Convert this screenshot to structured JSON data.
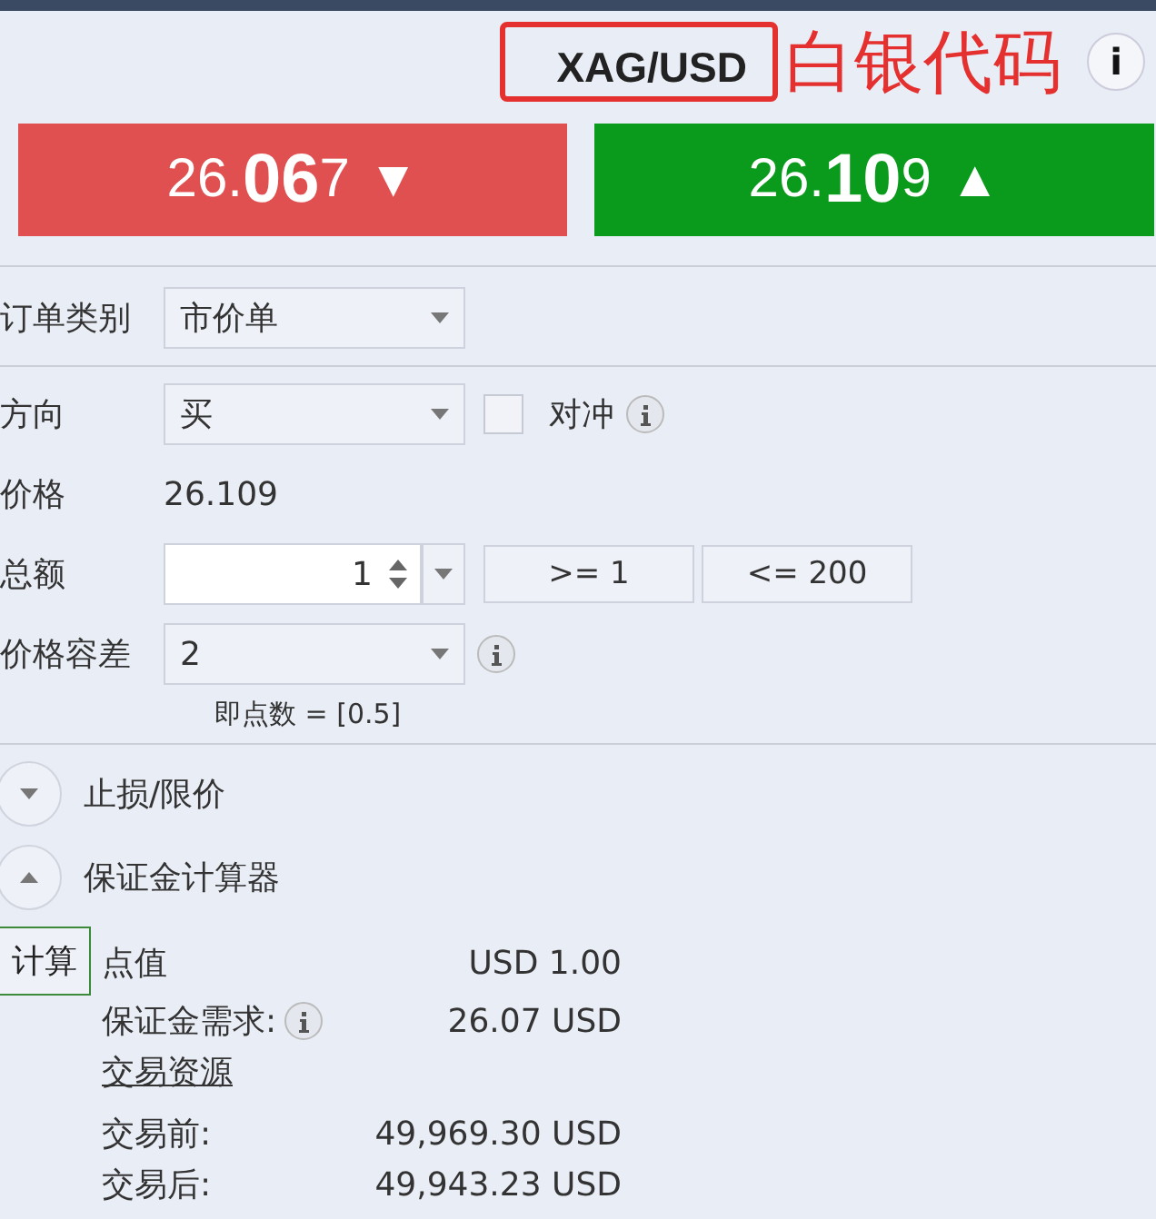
{
  "header": {
    "symbol": "XAG/USD",
    "symbol_highlighted": true,
    "annotation": "白银代码",
    "info": "i"
  },
  "quotes": [
    {
      "kind": "sell",
      "prefix": "26.",
      "big": "06",
      "suffix": "7",
      "arrow": "▼"
    },
    {
      "kind": "buy",
      "prefix": "26.",
      "big": "10",
      "suffix": "9",
      "arrow": "▲"
    }
  ],
  "order_type": {
    "label": "订单类别",
    "value": "市价单"
  },
  "direction": {
    "label": "方向",
    "value": "买",
    "hedge": {
      "label": "对冲",
      "checked": false
    }
  },
  "price": {
    "label": "价格",
    "value": "26.109"
  },
  "amount": {
    "label": "总额",
    "value": "1",
    "min": ">= 1",
    "max": "<= 200"
  },
  "slippage": {
    "label": "价格容差",
    "value": "2",
    "note": "即点数 = [0.5]"
  },
  "sections": [
    {
      "label": "止损/限价",
      "expanded": false
    },
    {
      "label": "保证金计算器",
      "expanded": true
    }
  ],
  "calculator": {
    "button": "计算",
    "rows": [
      {
        "label": "点值",
        "value": "USD 1.00",
        "info": false
      },
      {
        "label": "保证金需求:",
        "value": "26.07 USD",
        "info": true
      }
    ],
    "link": "交易资源",
    "balances": [
      {
        "label": "交易前:",
        "value": "49,969.30 USD"
      },
      {
        "label": "交易后:",
        "value": "49,943.23 USD"
      }
    ]
  }
}
